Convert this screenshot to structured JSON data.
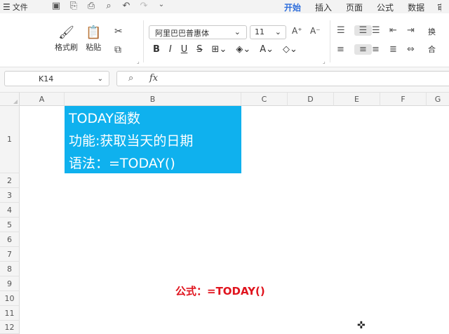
{
  "menubar": {
    "file_label": "文件",
    "tabs": [
      "开始",
      "插入",
      "页面",
      "公式",
      "数据"
    ],
    "active_tab": "开始",
    "overflow_tab": "审"
  },
  "ribbon": {
    "format_painter": "格式刷",
    "paste": "粘贴",
    "font_name": "阿里巴巴普惠体",
    "font_size": "11",
    "wrap_label": "换",
    "merge_label": "合"
  },
  "formula_bar": {
    "name_box": "K14",
    "fx_label": "fx",
    "formula": ""
  },
  "sheet": {
    "columns": [
      "A",
      "B",
      "C",
      "D",
      "E",
      "F",
      "G"
    ],
    "rows": [
      "1",
      "2",
      "3",
      "4",
      "5",
      "6",
      "7",
      "8",
      "9",
      "10",
      "11",
      "12"
    ],
    "cell_b1_lines": [
      "TODAY函数",
      "功能:获取当天的日期",
      "语法：=TODAY()"
    ],
    "cell_b1_fill": "#0fb1ee",
    "annotation": "公式：=TODAY()",
    "annotation_color": "#e0141e"
  },
  "colors": {
    "accent": "#2f6fdc"
  }
}
